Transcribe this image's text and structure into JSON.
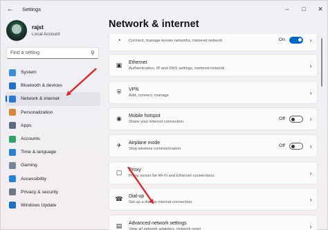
{
  "window": {
    "app_title": "Settings",
    "back_icon": "back-arrow-icon",
    "controls": [
      "minimize-icon",
      "maximize-icon",
      "close-icon"
    ]
  },
  "profile": {
    "name": "rajst",
    "account_type": "Local Account"
  },
  "search": {
    "placeholder": "Find a setting",
    "icon": "search-icon"
  },
  "sidebar": {
    "items": [
      {
        "label": "System",
        "icon": "monitor-icon",
        "color": "#3b8ed8"
      },
      {
        "label": "Bluetooth & devices",
        "icon": "bluetooth-icon",
        "color": "#1f6fc8"
      },
      {
        "label": "Network & internet",
        "icon": "wifi-icon",
        "color": "#2a79d6",
        "active": true
      },
      {
        "label": "Personalization",
        "icon": "brush-icon",
        "color": "#d9873a"
      },
      {
        "label": "Apps",
        "icon": "apps-icon",
        "color": "#5b6b84"
      },
      {
        "label": "Accounts",
        "icon": "person-icon",
        "color": "#2fa36b"
      },
      {
        "label": "Time & language",
        "icon": "globe-clock-icon",
        "color": "#2a7fd6"
      },
      {
        "label": "Gaming",
        "icon": "gamepad-icon",
        "color": "#7a8596"
      },
      {
        "label": "Accessibility",
        "icon": "accessibility-icon",
        "color": "#2a7fd6"
      },
      {
        "label": "Privacy & security",
        "icon": "shield-icon",
        "color": "#6c7788"
      },
      {
        "label": "Windows Update",
        "icon": "update-icon",
        "color": "#1f6fc8"
      }
    ]
  },
  "main": {
    "title": "Network & internet",
    "cards": [
      {
        "title": "",
        "subtitle": "Connect, manage known networks, metered network",
        "icon": "wifi-icon",
        "control": "toggle",
        "state_label": "On",
        "on": true
      },
      {
        "title": "Ethernet",
        "subtitle": "Authentication, IP and DNS settings, metered network",
        "icon": "ethernet-icon",
        "control": "chevron"
      },
      {
        "title": "VPN",
        "subtitle": "Add, connect, manage",
        "icon": "vpn-shield-icon",
        "control": "chevron"
      },
      {
        "title": "Mobile hotspot",
        "subtitle": "Share your internet connection",
        "icon": "hotspot-icon",
        "control": "toggle",
        "state_label": "Off",
        "on": false
      },
      {
        "title": "Airplane mode",
        "subtitle": "Stop wireless communication",
        "icon": "airplane-icon",
        "control": "toggle",
        "state_label": "Off",
        "on": false
      },
      {
        "title": "Proxy",
        "subtitle": "Proxy server for Wi-Fi and Ethernet connections",
        "icon": "proxy-icon",
        "control": "chevron"
      },
      {
        "title": "Dial-up",
        "subtitle": "Set up a dial-up internet connection",
        "icon": "dialup-icon",
        "control": "chevron"
      },
      {
        "title": "Advanced network settings",
        "subtitle": "View all network adapters, network reset",
        "icon": "network-adapter-icon",
        "control": "chevron"
      }
    ]
  },
  "colors": {
    "accent": "#0067c0",
    "annotation_arrow": "#d9262b"
  }
}
